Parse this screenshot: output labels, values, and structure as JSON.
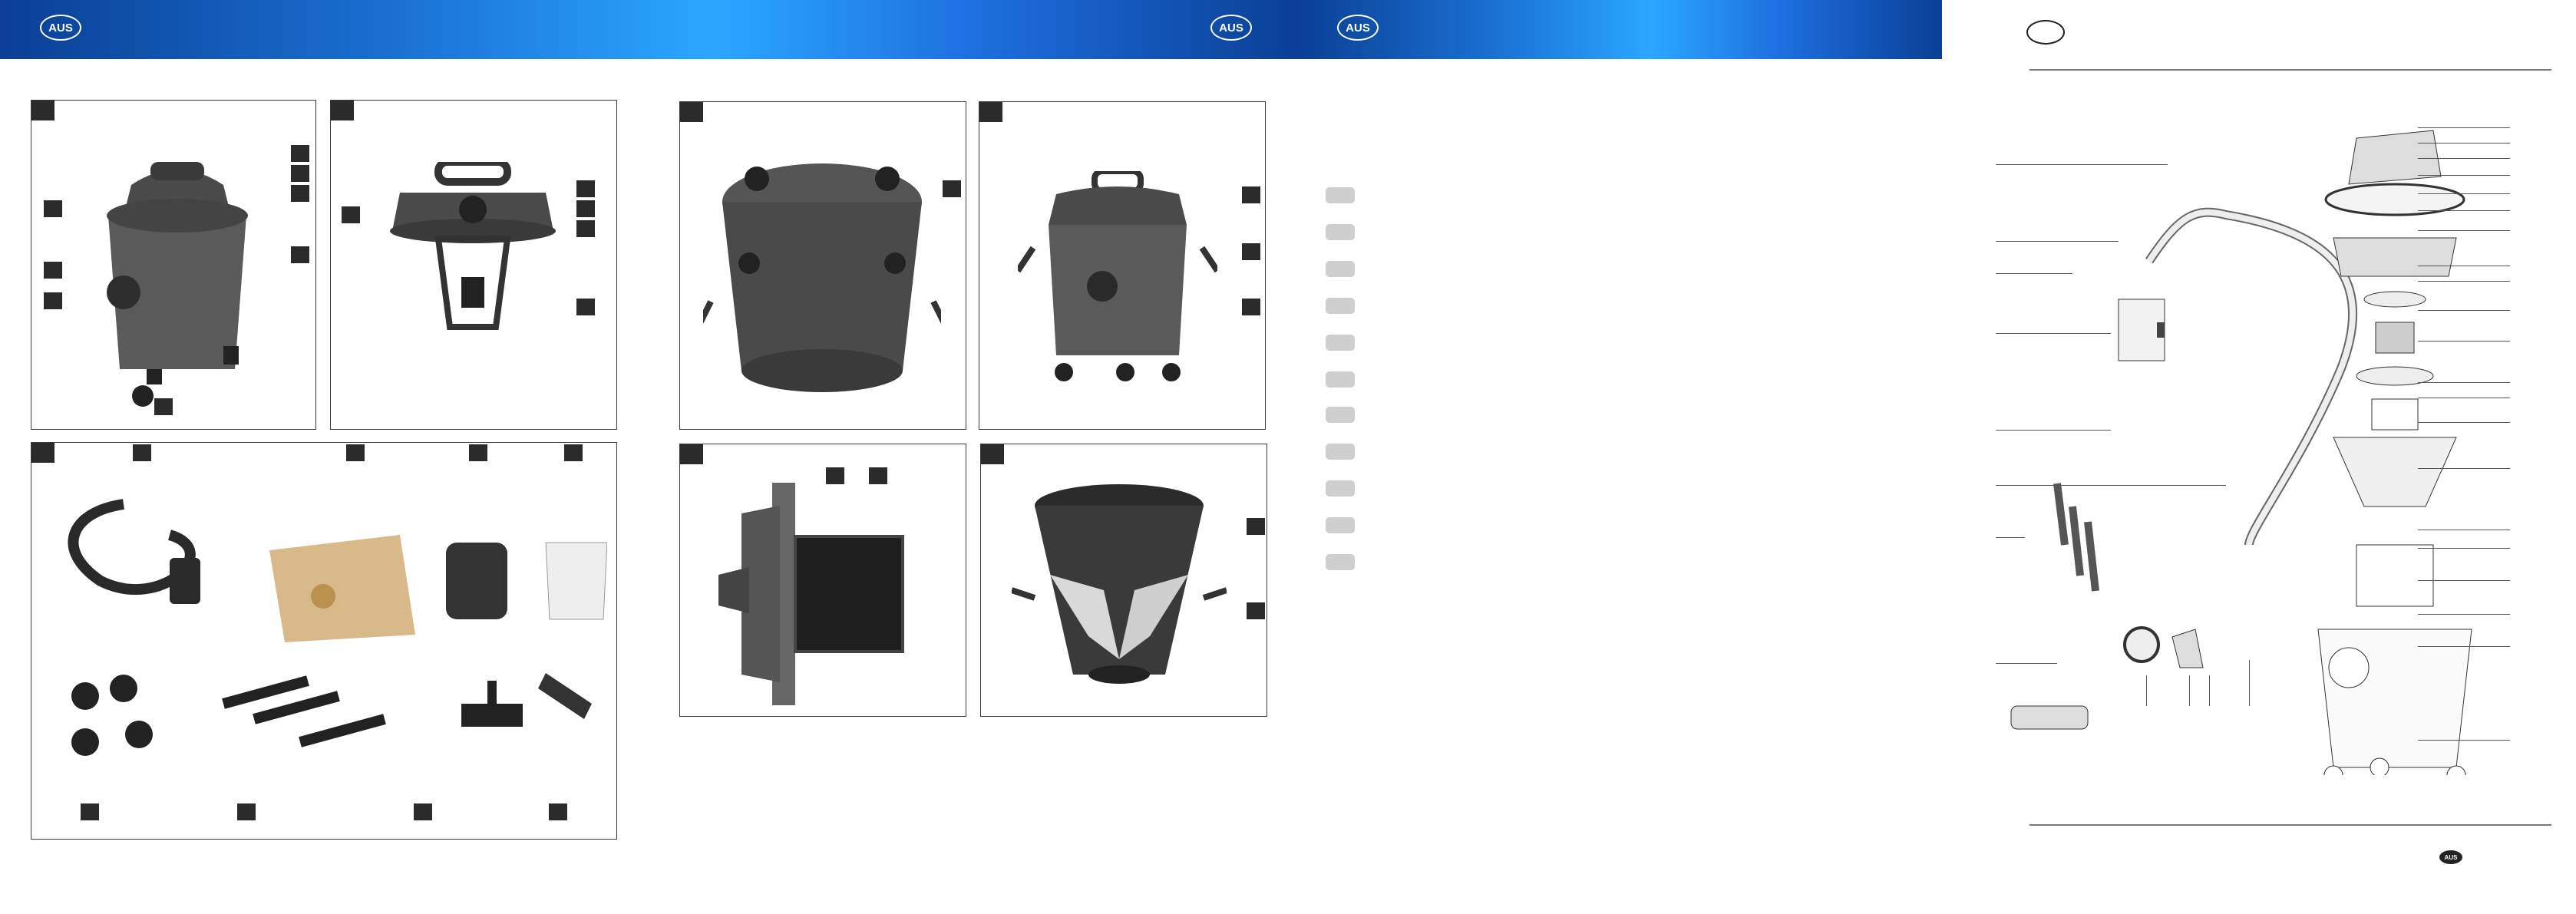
{
  "header": {
    "badges": [
      "AUS",
      "AUS",
      "AUS"
    ],
    "footer_badge": "AUS"
  },
  "colors": {
    "banner_dark": "#0a3f95",
    "banner_light": "#2aa7ff",
    "marker": "#2b2b2b",
    "pill": "#cfcfcf"
  },
  "figures": [
    {
      "id": "fig-vacuum-front",
      "icon": "wet-dry-vacuum-icon"
    },
    {
      "id": "fig-head-with-filter",
      "icon": "motor-head-icon"
    },
    {
      "id": "fig-accessories",
      "icon": "accessories-icon"
    },
    {
      "id": "fig-head-top",
      "icon": "motor-head-top-icon"
    },
    {
      "id": "fig-vacuum-side",
      "icon": "wet-dry-vacuum-icon"
    },
    {
      "id": "fig-foam-filter",
      "icon": "foam-filter-icon"
    },
    {
      "id": "fig-bag-in-tank",
      "icon": "tank-bag-icon"
    }
  ],
  "legend_count": 11,
  "exploded_view": {
    "icon": "exploded-diagram-icon"
  }
}
